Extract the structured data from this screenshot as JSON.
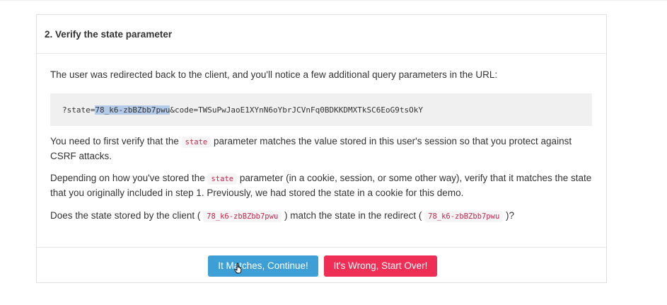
{
  "step": {
    "title": "2. Verify the state parameter"
  },
  "body": {
    "intro": "The user was redirected back to the client, and you'll notice a few additional query parameters in the URL:",
    "query": {
      "prefix": "?state=",
      "state_value": "78_k6-zbBZbb7pwu",
      "suffix": "&code=TWSuPwJaoE1XYnN6oYbrJCVnFq0BDKKDMXTkSC6EoG9tsOkY"
    },
    "verify": {
      "before": "You need to first verify that the ",
      "code": "state",
      "after": " parameter matches the value stored in this user's session so that you protect against CSRF attacks."
    },
    "depend": {
      "before": "Depending on how you've stored the ",
      "code": "state",
      "after": " parameter (in a cookie, session, or some other way), verify that it matches the state that you originally included in step 1. Previously, we had stored the state in a cookie for this demo."
    },
    "question": {
      "part1": "Does the state stored by the client ( ",
      "client_state": "78_k6-zbBZbb7pwu",
      "part2": " ) match the state in the redirect ( ",
      "redirect_state": "78_k6-zbBZbb7pwu",
      "part3": " )?"
    }
  },
  "actions": {
    "continue_label": "It Matches, Continue!",
    "restart_label": "It's Wrong, Start Over!"
  },
  "colors": {
    "continue_bg": "#3d9fd6",
    "restart_bg": "#ef2e55",
    "code_text": "#c7254e",
    "selection": "#b3cbe8"
  },
  "icons": {
    "cursor": "hand-pointer-cursor-icon"
  }
}
